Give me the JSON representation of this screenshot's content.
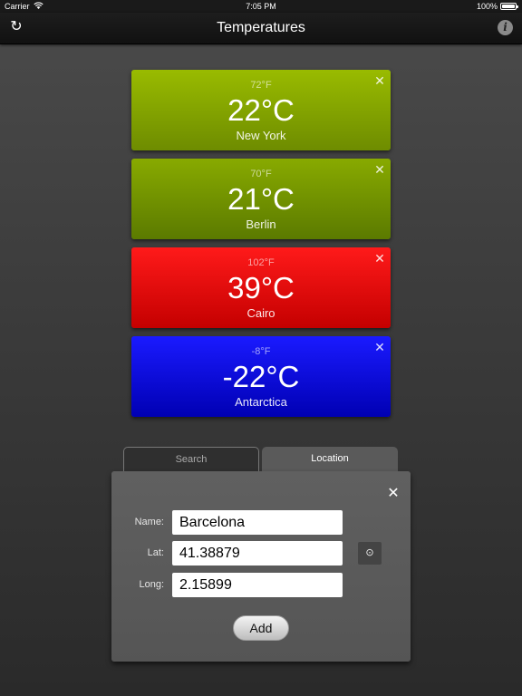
{
  "status_bar": {
    "carrier": "Carrier",
    "time": "7:05 PM",
    "battery": "100%"
  },
  "nav": {
    "title": "Temperatures",
    "refresh_icon": "refresh-icon",
    "info_icon": "info-icon",
    "info_glyph": "i"
  },
  "cities": [
    {
      "fahrenheit": "72°F",
      "celsius": "22°C",
      "name": "New York",
      "color": "#88aa00"
    },
    {
      "fahrenheit": "70°F",
      "celsius": "21°C",
      "name": "Berlin",
      "color": "#779900"
    },
    {
      "fahrenheit": "102°F",
      "celsius": "39°C",
      "name": "Cairo",
      "color": "#ee0000"
    },
    {
      "fahrenheit": "-8°F",
      "celsius": "-22°C",
      "name": "Antarctica",
      "color": "#0000ee"
    }
  ],
  "tabs": {
    "search": "Search",
    "location": "Location",
    "active": "Location"
  },
  "form": {
    "name_label": "Name:",
    "name_value": "Barcelona",
    "lat_label": "Lat:",
    "lat_value": "41.38879",
    "long_label": "Long:",
    "long_value": "2.15899",
    "add_label": "Add",
    "locate_icon": "locate-icon"
  }
}
